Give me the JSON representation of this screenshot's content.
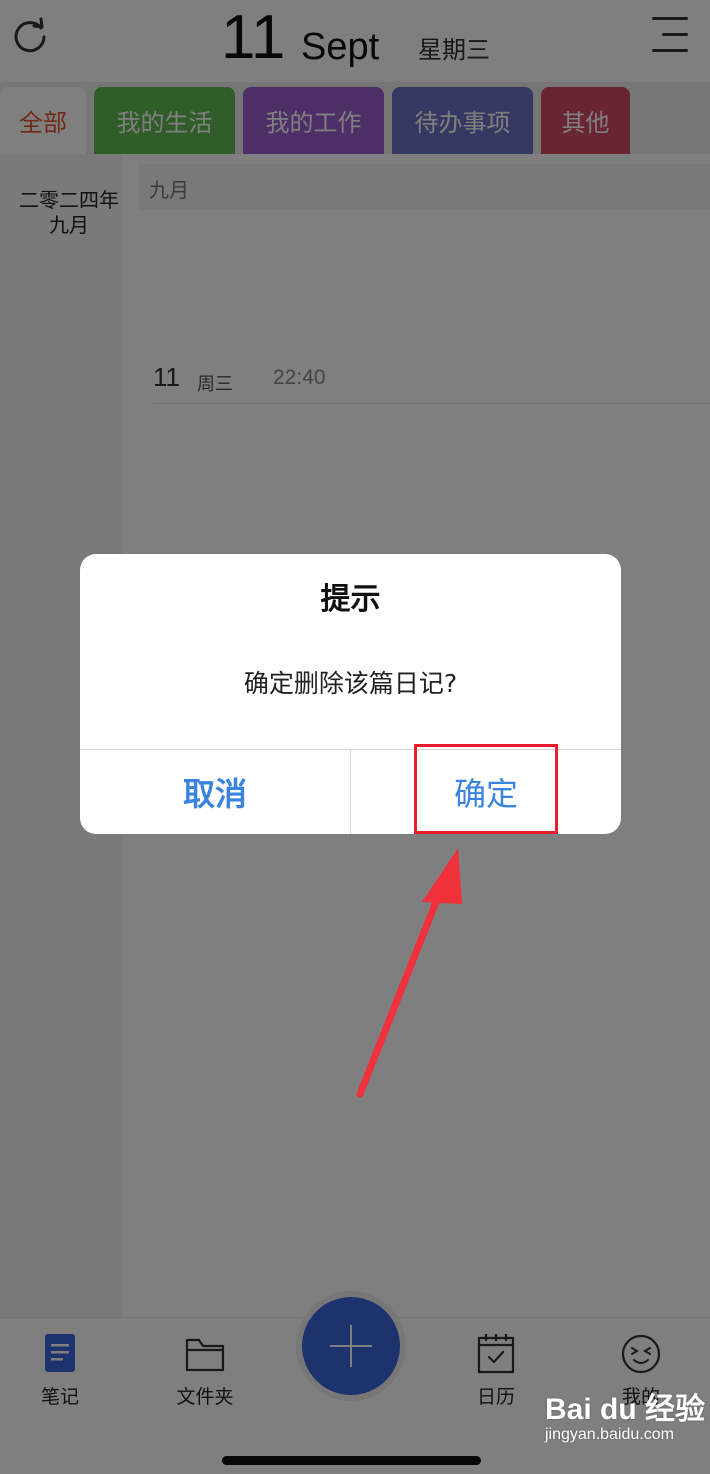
{
  "header": {
    "day": "11",
    "month": "Sept",
    "weekday": "星期三",
    "refresh_icon": "refresh-icon",
    "menu_icon": "menu-icon"
  },
  "tabs": [
    {
      "label": "全部",
      "color": "#e2562b"
    },
    {
      "label": "我的生活",
      "color": "#5fb94f"
    },
    {
      "label": "我的工作",
      "color": "#9b5ccf"
    },
    {
      "label": "待办事项",
      "color": "#6a70c2"
    },
    {
      "label": "其他",
      "color": "#d34a63"
    }
  ],
  "sidebar": {
    "year": "二零二四年",
    "month": "九月"
  },
  "content": {
    "month_header": "九月",
    "entry": {
      "day": "11",
      "weekday": "周三",
      "time": "22:40"
    }
  },
  "dialog": {
    "title": "提示",
    "message": "确定删除该篇日记?",
    "cancel_label": "取消",
    "confirm_label": "确定",
    "button_color": "#3a84e0"
  },
  "bottom_nav": {
    "items": [
      {
        "label": "笔记",
        "icon": "note-icon"
      },
      {
        "label": "文件夹",
        "icon": "folder-icon"
      },
      {
        "label": "日历",
        "icon": "calendar-icon"
      },
      {
        "label": "我的",
        "icon": "smiley-icon"
      }
    ],
    "add_icon": "plus-icon",
    "accent": "#3a66db"
  },
  "annotation": {
    "highlight_color": "#e81f2a"
  },
  "watermark": {
    "logo": "Bai du 经验",
    "url": "jingyan.baidu.com"
  }
}
